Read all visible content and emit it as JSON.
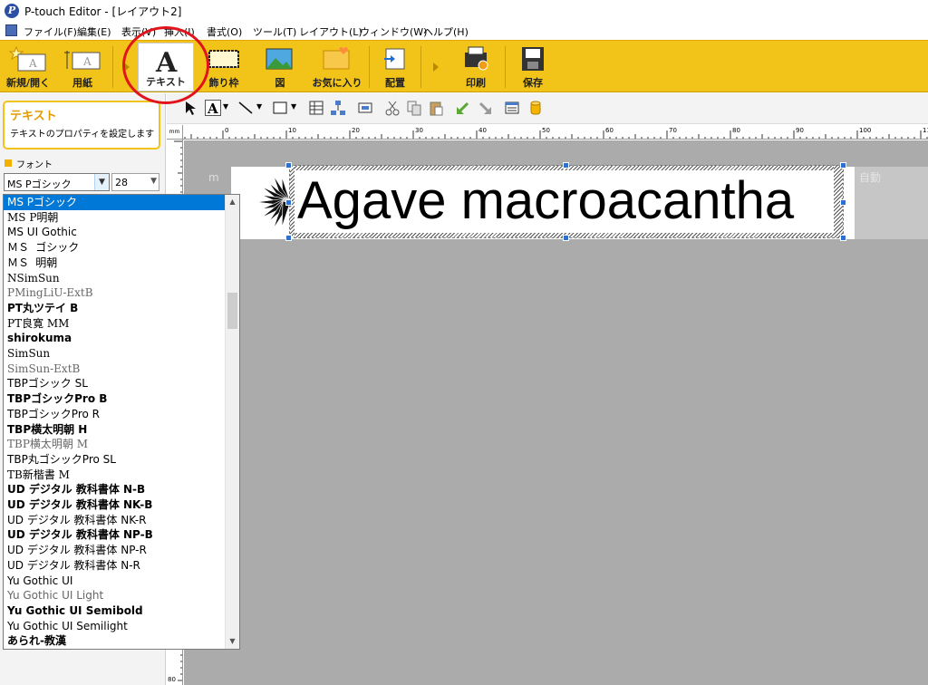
{
  "titlebar": {
    "title": "P-touch Editor - [レイアウト2]",
    "logo_letter": "P"
  },
  "menubar": {
    "items": [
      "ファイル(F)",
      "編集(E)",
      "表示(V)",
      "挿入(I)",
      "書式(O)",
      "ツール(T)",
      "レイアウト(L)",
      "ウィンドウ(W)",
      "ヘルプ(H)"
    ]
  },
  "ribbon": {
    "buttons": [
      {
        "label": "新規/開く",
        "icon": "new-open-icon"
      },
      {
        "label": "用紙",
        "icon": "paper-icon"
      },
      {
        "label": "テキスト",
        "icon": "text-icon",
        "active": true
      },
      {
        "label": "飾り枠",
        "icon": "frame-icon"
      },
      {
        "label": "図",
        "icon": "image-icon"
      },
      {
        "label": "お気に入り",
        "icon": "favorites-icon"
      },
      {
        "label": "配置",
        "icon": "arrange-icon"
      },
      {
        "label": "印刷",
        "icon": "print-icon"
      },
      {
        "label": "保存",
        "icon": "save-icon"
      }
    ],
    "highlight_color": "#e0151b",
    "accent_color": "#f2c419"
  },
  "sidepanel": {
    "tip_title": "テキスト",
    "tip_desc": "テキストのプロパティを設定します",
    "font_section": "フォント",
    "font_value": "MS Pゴシック",
    "size_value": "28"
  },
  "font_list": {
    "selected_index": 0,
    "items": [
      "MS Pゴシック",
      "MS P明朝",
      "MS UI Gothic",
      "ＭＳ ゴシック",
      "ＭＳ 明朝",
      "NSimSun",
      "PMingLiU-ExtB",
      "PT丸ツテイ B",
      "PT良寛 MM",
      "shirokuma",
      "SimSun",
      "SimSun-ExtB",
      "TBPゴシック SL",
      "TBPゴシックPro B",
      "TBPゴシックPro R",
      "TBP横太明朝 H",
      "TBP横太明朝 M",
      "TBP丸ゴシックPro SL",
      "TB新楷書 M",
      "UD デジタル 教科書体 N-B",
      "UD デジタル 教科書体 NK-B",
      "UD デジタル 教科書体 NK-R",
      "UD デジタル 教科書体 NP-B",
      "UD デジタル 教科書体 NP-R",
      "UD デジタル 教科書体 N-R",
      "Yu Gothic UI",
      "Yu Gothic UI Light",
      "Yu Gothic UI Semibold",
      "Yu Gothic UI Semilight",
      "あられ-教漢"
    ]
  },
  "ruler": {
    "unit": "mm",
    "h_labels": [
      "0",
      "10",
      "20",
      "30",
      "40",
      "50",
      "60",
      "70",
      "80",
      "90",
      "100",
      "110"
    ],
    "v_last": "80"
  },
  "canvas": {
    "label_text": "Agave macroacantha",
    "auto_label": "自動",
    "faded_text": "m"
  },
  "toolbar": {
    "tools": [
      "select-arrow-icon",
      "text-tool-icon",
      "line-tool-icon",
      "rectangle-tool-icon",
      "table-tool-icon",
      "tree-tool-icon",
      "layout-tool-icon",
      "cut-icon",
      "copy-icon",
      "paste-icon",
      "undo-icon",
      "redo-icon",
      "properties-icon",
      "database-icon"
    ]
  }
}
